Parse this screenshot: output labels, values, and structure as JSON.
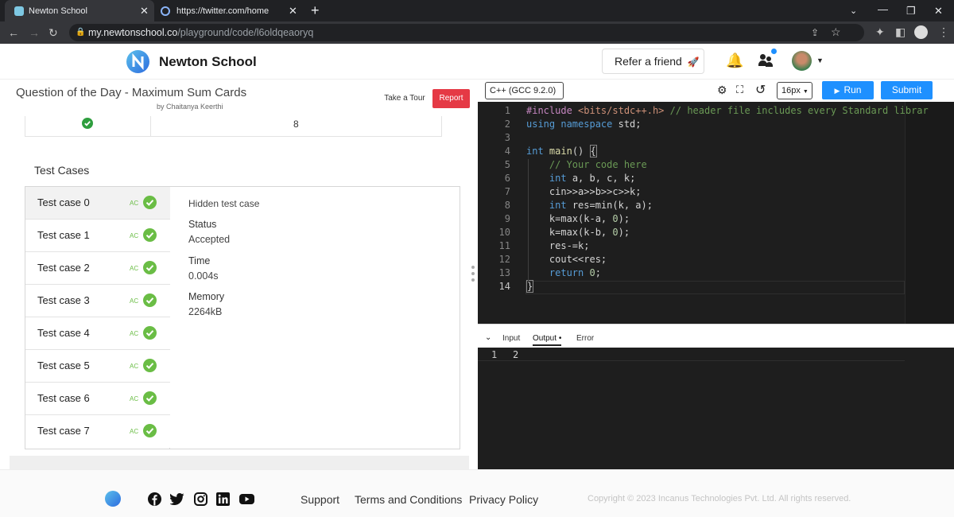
{
  "browser": {
    "tabs": [
      {
        "title": "Newton School"
      },
      {
        "title": "https://twitter.com/home"
      }
    ],
    "url_host": "my.newtonschool.co",
    "url_path": "/playground/code/l6oldqeaoryq"
  },
  "header": {
    "brand": "Newton School",
    "refer_label": "Refer a friend",
    "rocket_icon": "🚀"
  },
  "question": {
    "title": "Question of the Day - Maximum Sum Cards",
    "author": "by Chaitanya Keerthi",
    "take_tour": "Take a Tour",
    "report": "Report",
    "prev_row_value": "8"
  },
  "test_cases": {
    "heading": "Test Cases",
    "items": [
      {
        "label": "Test case 0",
        "status": "AC"
      },
      {
        "label": "Test case 1",
        "status": "AC"
      },
      {
        "label": "Test case 2",
        "status": "AC"
      },
      {
        "label": "Test case 3",
        "status": "AC"
      },
      {
        "label": "Test case 4",
        "status": "AC"
      },
      {
        "label": "Test case 5",
        "status": "AC"
      },
      {
        "label": "Test case 6",
        "status": "AC"
      },
      {
        "label": "Test case 7",
        "status": "AC"
      }
    ],
    "detail": {
      "hidden": "Hidden test case",
      "status_label": "Status",
      "status_value": "Accepted",
      "time_label": "Time",
      "time_value": "0.004s",
      "memory_label": "Memory",
      "memory_value": "2264kB"
    }
  },
  "editor": {
    "language": "C++ (GCC 9.2.0)",
    "font_size": "16px",
    "run_label": "Run",
    "submit_label": "Submit",
    "line_numbers": [
      "1",
      "2",
      "3",
      "4",
      "5",
      "6",
      "7",
      "8",
      "9",
      "10",
      "11",
      "12",
      "13",
      "14"
    ],
    "io_tabs": {
      "input": "Input",
      "output": "Output",
      "error": "Error"
    },
    "output_line_number": "1",
    "output_value": "2"
  },
  "footer": {
    "support": "Support",
    "terms": "Terms and Conditions",
    "privacy": "Privacy Policy",
    "copyright": "Copyright © 2023 Incanus Technologies Pvt. Ltd. All rights reserved."
  },
  "colors": {
    "accent_blue": "#1e90ff",
    "report_red": "#e53945",
    "ac_green": "#6abd45"
  }
}
